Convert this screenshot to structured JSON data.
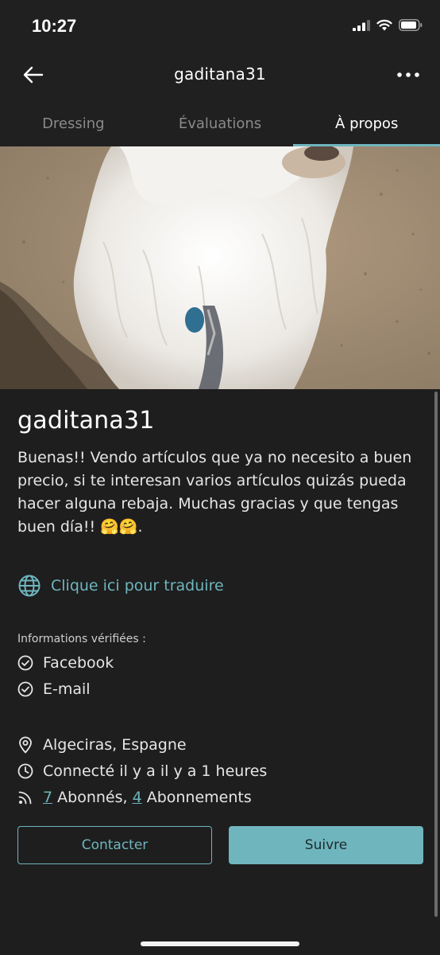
{
  "status_bar": {
    "time": "10:27"
  },
  "navbar": {
    "title": "gaditana31"
  },
  "tabs": [
    {
      "label": "Dressing",
      "active": false
    },
    {
      "label": "Évaluations",
      "active": false
    },
    {
      "label": "À propos",
      "active": true
    }
  ],
  "profile": {
    "username": "gaditana31",
    "bio": "Buenas!! Vendo artículos que ya no necesito a buen precio, si te interesan varios artículos quizás pueda hacer alguna rebaja. Muchas gracias y que tengas buen día!! 🤗🤗.",
    "translate_label": "Clique ici pour traduire"
  },
  "verified": {
    "title": "Informations vérifiées :",
    "items": [
      "Facebook",
      "E-mail"
    ]
  },
  "details": {
    "location": "Algeciras, Espagne",
    "last_seen": "Connecté il y a il y a 1 heures",
    "followers_count": "7",
    "followers_label": " Abonnés, ",
    "following_count": "4",
    "following_label": " Abonnements"
  },
  "actions": {
    "contact_label": "Contacter",
    "follow_label": "Suivre"
  },
  "colors": {
    "accent": "#6fb5be",
    "background": "#1e1e1e",
    "bar": "#202020"
  },
  "icons": {
    "back": "arrow-left-icon",
    "more": "more-horizontal-icon",
    "translate": "globe-icon",
    "verified": "check-circle-icon",
    "location": "map-pin-icon",
    "last_seen": "clock-icon",
    "followers": "rss-icon"
  }
}
